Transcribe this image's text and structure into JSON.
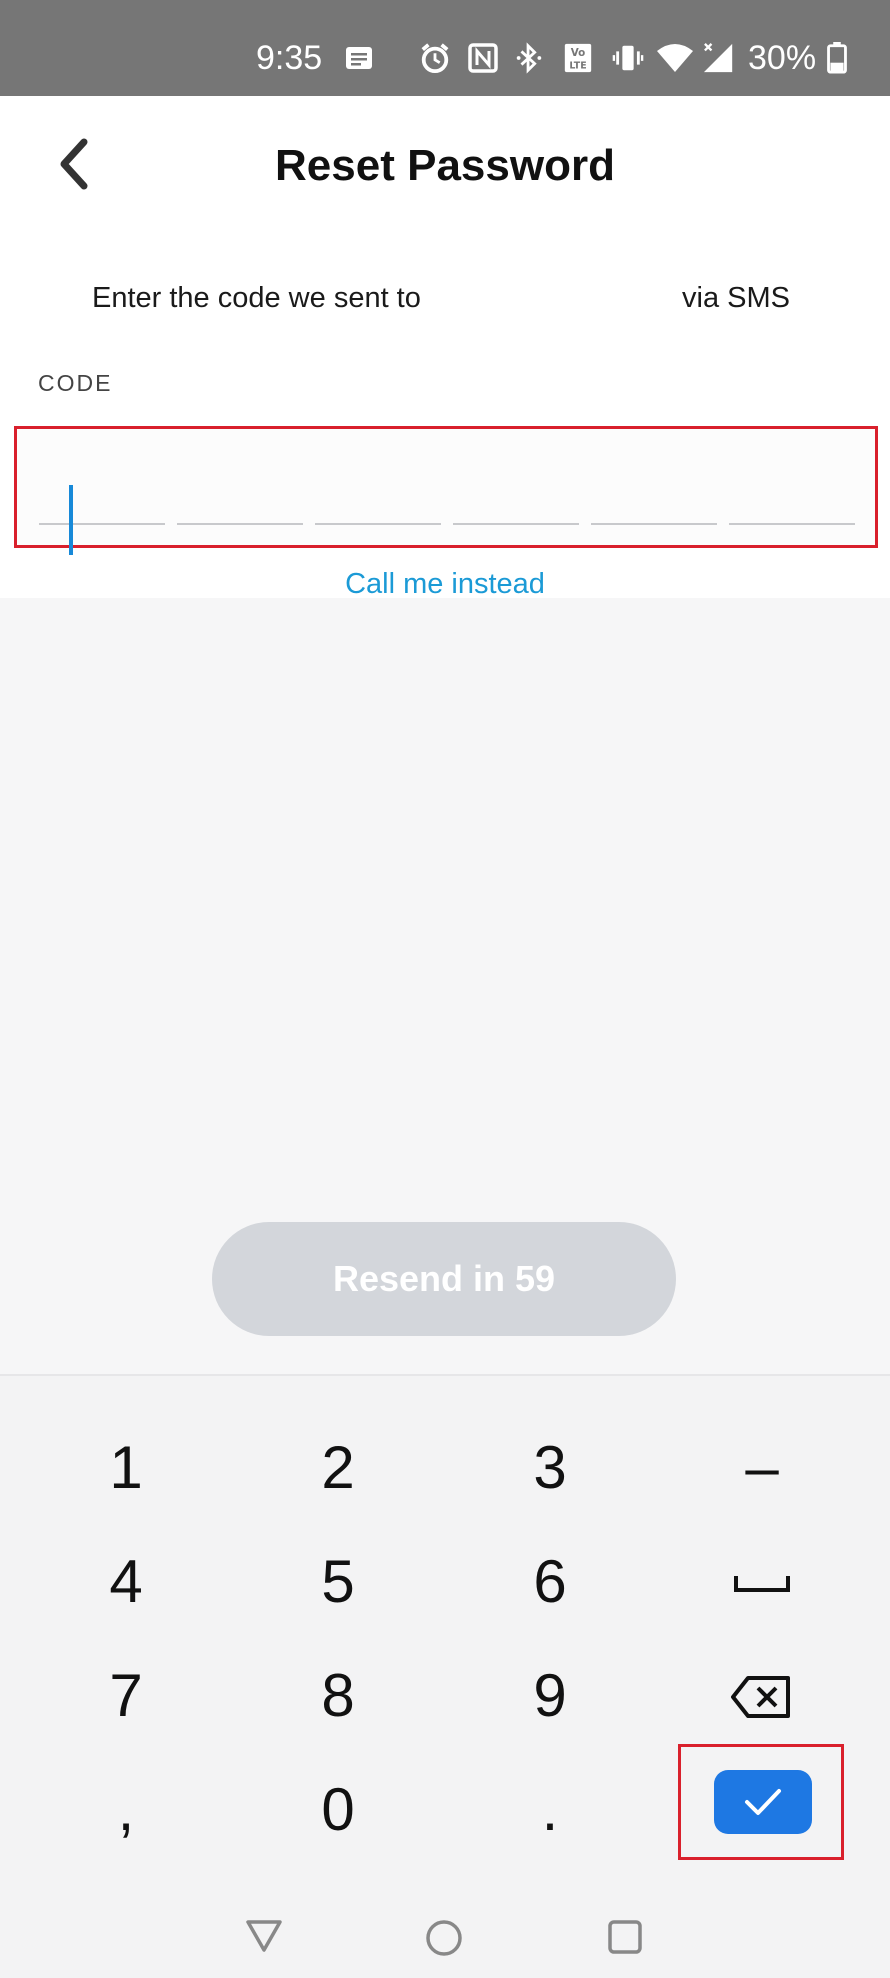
{
  "status_bar": {
    "time": "9:35",
    "battery_text": "30%",
    "icons": [
      "message-icon",
      "alarm-icon",
      "nfc-icon",
      "bluetooth-icon",
      "volte-icon",
      "vibrate-icon",
      "wifi-icon",
      "signal-icon",
      "battery-icon"
    ]
  },
  "header": {
    "title": "Reset Password",
    "back_icon": "chevron-left-icon"
  },
  "instructions": {
    "prefix": "Enter the code we sent to",
    "suffix": "via SMS"
  },
  "code": {
    "label": "CODE",
    "digits": 6,
    "value": ""
  },
  "call_link": "Call me instead",
  "resend_label": "Resend in 59",
  "keyboard": {
    "keys": [
      "1",
      "2",
      "3",
      "–",
      "4",
      "5",
      "6",
      "␣",
      "7",
      "8",
      "9",
      "⌫",
      ",",
      "0",
      ".",
      "✓"
    ],
    "icons": [
      "space-icon",
      "backspace-icon",
      "checkmark-icon"
    ]
  },
  "nav_bar": {
    "icons": [
      "back-triangle-icon",
      "home-circle-icon",
      "recents-square-icon"
    ]
  },
  "colors": {
    "accent_blue": "#1e78e3",
    "link_blue": "#1b9ad6",
    "highlight_red": "#d9202c",
    "disabled_button": "#d3d6db",
    "status_bar": "#767676"
  }
}
